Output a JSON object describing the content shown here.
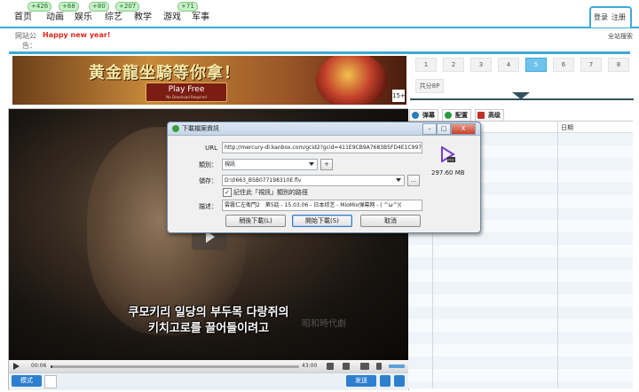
{
  "nav": {
    "items": [
      {
        "label": "首页",
        "badge": ""
      },
      {
        "label": "动画",
        "badge": "+426"
      },
      {
        "label": "娱乐",
        "badge": "+68"
      },
      {
        "label": "综艺",
        "badge": "+80"
      },
      {
        "label": "教学",
        "badge": "+207"
      },
      {
        "label": "游戏",
        "badge": ""
      },
      {
        "label": "军事",
        "badge": "+71"
      }
    ],
    "login": "登录",
    "register": "注册"
  },
  "notice": {
    "label": "网站公告：",
    "message": "Happy new year!",
    "site_search": "全站搜索"
  },
  "banner": {
    "title": "黄金龍坐騎等你拿！",
    "play": "Play Free",
    "sub": "No Download Required",
    "age": "15+"
  },
  "pager": {
    "pages": [
      "1",
      "2",
      "3",
      "4",
      "5",
      "6",
      "7",
      "8"
    ],
    "active_index": 4,
    "total": "共分8P"
  },
  "player": {
    "subtitle_line1": "쿠모키리 일당의 부두목 다랑쥐의",
    "subtitle_line2": "키치고로를 끌어들이려고",
    "watermark": "昭和時代劇",
    "current_time": "00:06",
    "total_time": "43:00",
    "progress": 0.002,
    "mode_button": "模式",
    "send_button": "发送"
  },
  "right_panel": {
    "tabs": [
      "弹幕",
      "配置",
      "高级"
    ],
    "column_date": "日期"
  },
  "dialog": {
    "title": "下載檔案資訊",
    "url_label": "URL",
    "url_value": "http://mercury-dl.kanbox.com/gcid2?gcid=411E9CB9A7683B5FD4E1C9975",
    "category_label": "類別：",
    "category_value": "視訊",
    "category_add": "+",
    "save_label": "儲存：",
    "save_value": "D:\\0663_B5B077198310E.flv",
    "browse": "...",
    "remember_label": "記住此「視訊」類別的路徑",
    "remember_checked": true,
    "desc_label": "描述：",
    "desc_value": "雲霧仁左衛門2　第5話 - 15.03.06 - 日本综艺 - MioMio弹幕网 - ( ^ω^)(",
    "file_size": "297.60  MB",
    "file_type": "FLV",
    "btn_later": "稍後下載(L)",
    "btn_start": "開始下載(S)",
    "btn_cancel": "取消",
    "win_min": "–",
    "win_max": "□",
    "win_close": "X"
  }
}
